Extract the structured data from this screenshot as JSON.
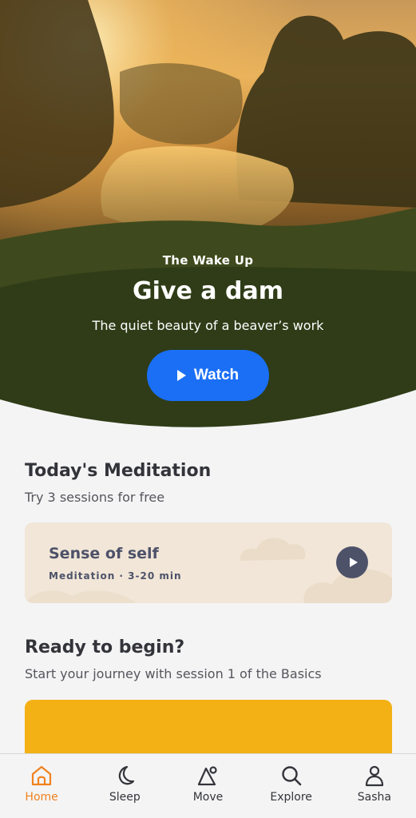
{
  "hero": {
    "eyebrow": "The Wake Up",
    "title": "Give a dam",
    "subtitle": "The quiet beauty of a beaver’s work",
    "watch_label": "Watch",
    "accent": "#1a6ff5"
  },
  "today": {
    "title": "Today's Meditation",
    "subtitle": "Try 3 sessions for free",
    "card": {
      "title": "Sense of self",
      "meta": "Meditation · 3-20 min"
    }
  },
  "ready": {
    "title": "Ready to begin?",
    "subtitle": "Start your journey with session 1 of the Basics",
    "card_color": "#f4b115"
  },
  "tabs": [
    {
      "label": "Home",
      "icon": "home-icon",
      "active": true
    },
    {
      "label": "Sleep",
      "icon": "moon-icon",
      "active": false
    },
    {
      "label": "Move",
      "icon": "move-icon",
      "active": false
    },
    {
      "label": "Explore",
      "icon": "search-icon",
      "active": false
    },
    {
      "label": "Sasha",
      "icon": "profile-icon",
      "active": false
    }
  ],
  "colors": {
    "active_tab": "#f0821e",
    "background": "#f4f4f5"
  }
}
